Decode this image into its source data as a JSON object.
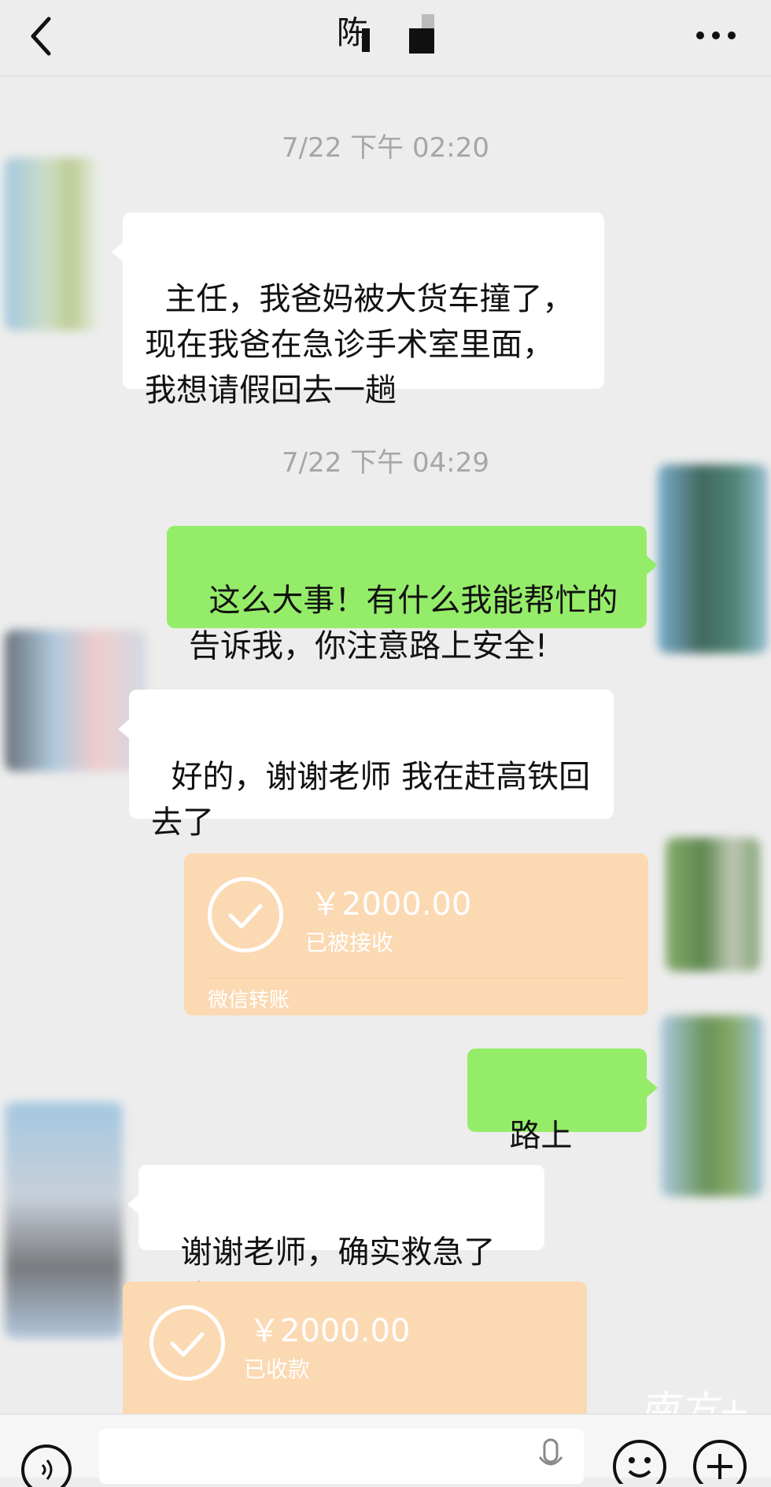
{
  "header": {
    "title": "陈",
    "back_icon": "chevron-left-icon",
    "more_icon": "more-horizontal-icon"
  },
  "messages": [
    {
      "type": "timestamp",
      "text": "7/22 下午 02:20"
    },
    {
      "type": "text",
      "side": "in",
      "text": "主任，我爸妈被大货车撞了，\n现在我爸在急诊手术室里面，\n我想请假回去一趟"
    },
    {
      "type": "timestamp",
      "text": "7/22 下午 04:29"
    },
    {
      "type": "text",
      "side": "out",
      "text": "这么大事！有什么我能帮忙的\n告诉我，你注意路上安全!"
    },
    {
      "type": "text",
      "side": "in",
      "text": "好的，谢谢老师 我在赶高铁回\n去了"
    },
    {
      "type": "transfer",
      "side": "out",
      "amount": "￥2000.00",
      "status": "已被接收",
      "label": "微信转账"
    },
    {
      "type": "text",
      "side": "out",
      "text": "路上用。"
    },
    {
      "type": "text",
      "side": "in",
      "text": "谢谢老师，确实救急了",
      "emoji": "folded-hands-emoji"
    },
    {
      "type": "transfer",
      "side": "in",
      "amount": "￥2000.00",
      "status": "已收款"
    }
  ],
  "watermark": {
    "text": "南方+"
  },
  "toolbar": {
    "voice_icon": "voice-icon",
    "mic_icon": "microphone-icon",
    "emoji_icon": "emoji-icon",
    "plus_icon": "plus-icon"
  },
  "colors": {
    "background": "#ededed",
    "bubble_out": "#95ec69",
    "bubble_in": "#ffffff",
    "transfer": "#fbd9b3",
    "timestamp": "#a6a6a6"
  }
}
